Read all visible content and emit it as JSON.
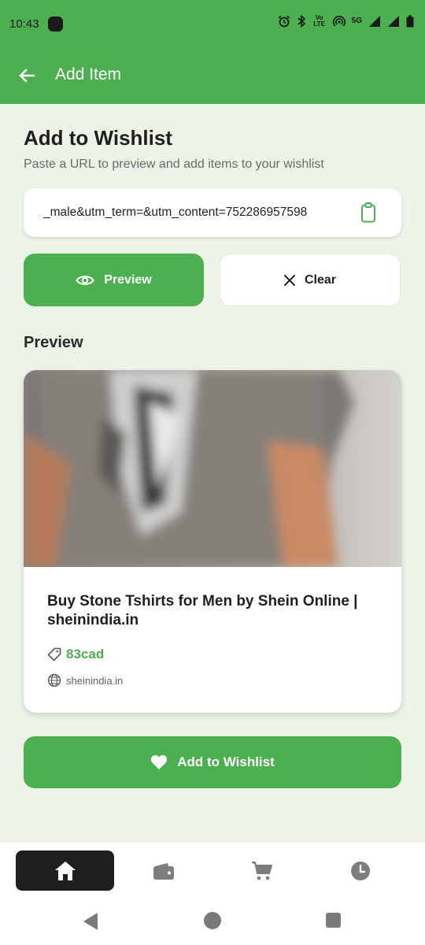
{
  "status_bar": {
    "time": "10:43",
    "network_label": "5G",
    "volte_label": "Vo LTE",
    "roaming_label": "R"
  },
  "app_bar": {
    "title": "Add Item",
    "back_icon": "arrow-left-icon"
  },
  "form": {
    "heading": "Add to Wishlist",
    "subheading": "Paste a URL to preview and add items to your wishlist",
    "url_value": "_male&utm_term=&utm_content=752286957598",
    "paste_icon": "clipboard-icon"
  },
  "buttons": {
    "preview_label": "Preview",
    "preview_icon": "eye-icon",
    "clear_label": "Clear",
    "clear_icon": "close-icon"
  },
  "preview": {
    "section_title": "Preview",
    "product_title": "Buy Stone Tshirts for Men by Shein Online | sheinindia.in",
    "price": "83cad",
    "price_icon": "tag-icon",
    "domain": "sheinindia.in",
    "domain_icon": "globe-icon"
  },
  "add_button": {
    "label": "Add to Wishlist",
    "icon": "heart-icon"
  },
  "bottom_nav": {
    "items": [
      {
        "id": "home",
        "icon": "home-icon",
        "active": true
      },
      {
        "id": "wallet",
        "icon": "wallet-icon",
        "active": false
      },
      {
        "id": "cart",
        "icon": "cart-icon",
        "active": false
      },
      {
        "id": "history",
        "icon": "clock-icon",
        "active": false
      }
    ]
  },
  "colors": {
    "primary": "#4caf50",
    "background": "#eef3e8",
    "nav_active": "#1f1f1f"
  }
}
